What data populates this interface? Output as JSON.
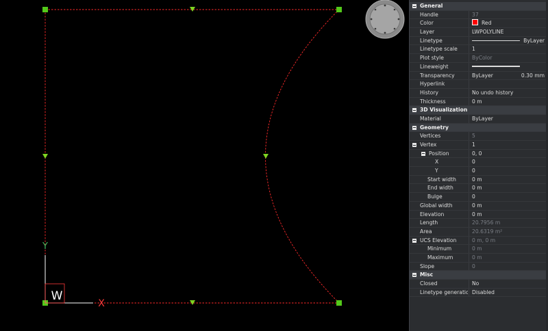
{
  "ucs": {
    "y_label": "Y",
    "x_label": "X",
    "w_label": "W"
  },
  "properties": {
    "general": {
      "title": "General",
      "handle": {
        "label": "Handle",
        "value": "37"
      },
      "color": {
        "label": "Color",
        "value": "Red",
        "swatch": "#ff0000"
      },
      "layer": {
        "label": "Layer",
        "value": "LWPOLYLINE"
      },
      "linetype": {
        "label": "Linetype",
        "value": "ByLayer"
      },
      "linetype_scale": {
        "label": "Linetype scale",
        "value": "1"
      },
      "plot_style": {
        "label": "Plot style",
        "value": "ByColor"
      },
      "lineweight": {
        "label": "Lineweight",
        "value": "0.30 mm"
      },
      "transparency": {
        "label": "Transparency",
        "value": "ByLayer"
      },
      "hyperlink": {
        "label": "Hyperlink",
        "value": ""
      },
      "history": {
        "label": "History",
        "value": "No undo history"
      },
      "thickness": {
        "label": "Thickness",
        "value": "0 m"
      }
    },
    "visualization": {
      "title": "3D Visualization",
      "material": {
        "label": "Material",
        "value": "ByLayer"
      }
    },
    "geometry": {
      "title": "Geometry",
      "vertices": {
        "label": "Vertices",
        "value": "5"
      },
      "vertex": {
        "label": "Vertex",
        "value": "1"
      },
      "position": {
        "label": "Position",
        "value": "0, 0"
      },
      "x": {
        "label": "X",
        "value": "0"
      },
      "y": {
        "label": "Y",
        "value": "0"
      },
      "start_width": {
        "label": "Start width",
        "value": "0 m"
      },
      "end_width": {
        "label": "End width",
        "value": "0 m"
      },
      "bulge": {
        "label": "Bulge",
        "value": "0"
      },
      "global_width": {
        "label": "Global width",
        "value": "0 m"
      },
      "elevation": {
        "label": "Elevation",
        "value": "0 m"
      },
      "length": {
        "label": "Length",
        "value": "20.7956 m"
      },
      "area": {
        "label": "Area",
        "value": "20.6319 m²"
      },
      "ucs_elevation": {
        "label": "UCS Elevation",
        "value": "0 m, 0 m"
      },
      "minimum": {
        "label": "Minimum",
        "value": "0 m"
      },
      "maximum": {
        "label": "Maximum",
        "value": "0 m"
      },
      "slope": {
        "label": "Slope",
        "value": "0"
      }
    },
    "misc": {
      "title": "Misc",
      "closed": {
        "label": "Closed",
        "value": "No"
      },
      "linetype_generation": {
        "label": "Linetype generation",
        "value": "Disabled"
      }
    }
  },
  "colors": {
    "entity": "#ff2a2a",
    "grip": "#53c91a",
    "grip_arrow": "#7ed321",
    "ucs": "#ffffff"
  }
}
